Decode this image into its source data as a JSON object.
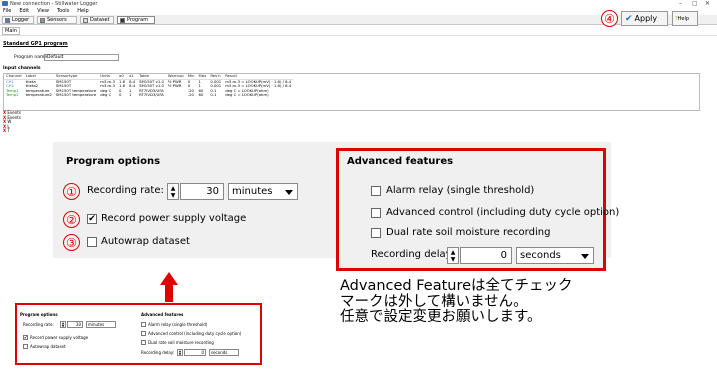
{
  "window": {
    "title": "New connection - Stillwater Logger",
    "controls": [
      "–",
      "▢",
      "✕"
    ]
  },
  "menu": [
    "File",
    "Edit",
    "View",
    "Tools",
    "Help"
  ],
  "tabs": [
    {
      "label": "Logger",
      "icon": "logger-icon"
    },
    {
      "label": "Sensors",
      "icon": "sensors-icon"
    },
    {
      "label": "Dataset",
      "icon": "dataset-icon"
    },
    {
      "label": "Program",
      "icon": "program-icon",
      "active": true
    }
  ],
  "subtab": "Main",
  "program": {
    "title": "Standard GP1 program",
    "name_label": "Program name:",
    "name_value": "Default"
  },
  "input_channels": {
    "title": "Input channels",
    "headers": [
      "Channel",
      "Label",
      "Sensortype",
      "Units",
      "a0",
      "a1",
      "Table",
      "Warmup",
      "Min",
      "Max",
      "Res'n",
      "Result"
    ],
    "rows": [
      [
        "CH1",
        "theta",
        "SM150T",
        "m3.m-3",
        "1.6",
        "8.4",
        "SM150T v1.0",
        "½ PWR",
        "0",
        "1",
        "0.001",
        "m3.m-3 = LOOKUP(mV) · 1.6) / 8.4"
      ],
      [
        "CH2",
        "theta2",
        "SM150T",
        "m3.m-3",
        "1.6",
        "8.4",
        "SM150T v1.0",
        "½ PWR",
        "0",
        "1",
        "0.001",
        "m3.m-3 = LOOKUP(mV) · 1.6) / 8.4"
      ],
      [
        "Temp1",
        "temperature",
        "SM150T temperature",
        "deg C",
        "0",
        "1",
        "RT7IVD3/UFA",
        "",
        "-20",
        "60",
        "0.1",
        "deg C = LOOKUP(ohm)"
      ],
      [
        "Temp2",
        "temperature2",
        "SM150T temperature",
        "deg C",
        "0",
        "1",
        "RT7IVD3/UFA",
        "",
        "-20",
        "60",
        "0.1",
        "deg C = LOOKUP(ohm)"
      ]
    ],
    "extras": [
      "Events",
      "Events",
      "W",
      "L",
      "T"
    ]
  },
  "program_options": {
    "title": "Program options",
    "recording_rate_label": "Recording rate:",
    "recording_rate_value": "30",
    "recording_rate_unit": "minutes",
    "record_power_label": "Record power supply voltage",
    "record_power_checked": true,
    "autowrap_label": "Autowrap dataset",
    "autowrap_checked": false
  },
  "advanced": {
    "title": "Advanced features",
    "alarm_label": "Alarm relay (single threshold)",
    "advanced_control_label": "Advanced control (including duty cycle option)",
    "dual_rate_label": "Dual rate soil moisture recording",
    "delay_label": "Recording delay:",
    "delay_value": "0",
    "delay_unit": "seconds"
  },
  "markers": [
    "①",
    "②",
    "③",
    "④"
  ],
  "note": [
    "Advanced Featureは全てチェック",
    "マークは外して構いません。",
    "任意で設定変更お願いします。"
  ],
  "mini": {
    "po_title": "Program options",
    "rate_label": "Recording rate:",
    "rate_value": "30",
    "rate_unit": "minutes",
    "power_label": "Record power supply voltage",
    "autowrap_label": "Autowrap dataset",
    "af_title": "Advanced features",
    "alarm_label": "Alarm relay (single threshold)",
    "control_label": "Advanced control (including duty cycle option)",
    "dual_label": "Dual rate soil moisture recording",
    "delay_label": "Recording delay:",
    "delay_value": "0",
    "delay_unit": "seconds"
  },
  "buttons": {
    "apply": "Apply",
    "help": "Help"
  },
  "colors": {
    "accent": "#e00000",
    "panel": "#f0f0f0"
  }
}
